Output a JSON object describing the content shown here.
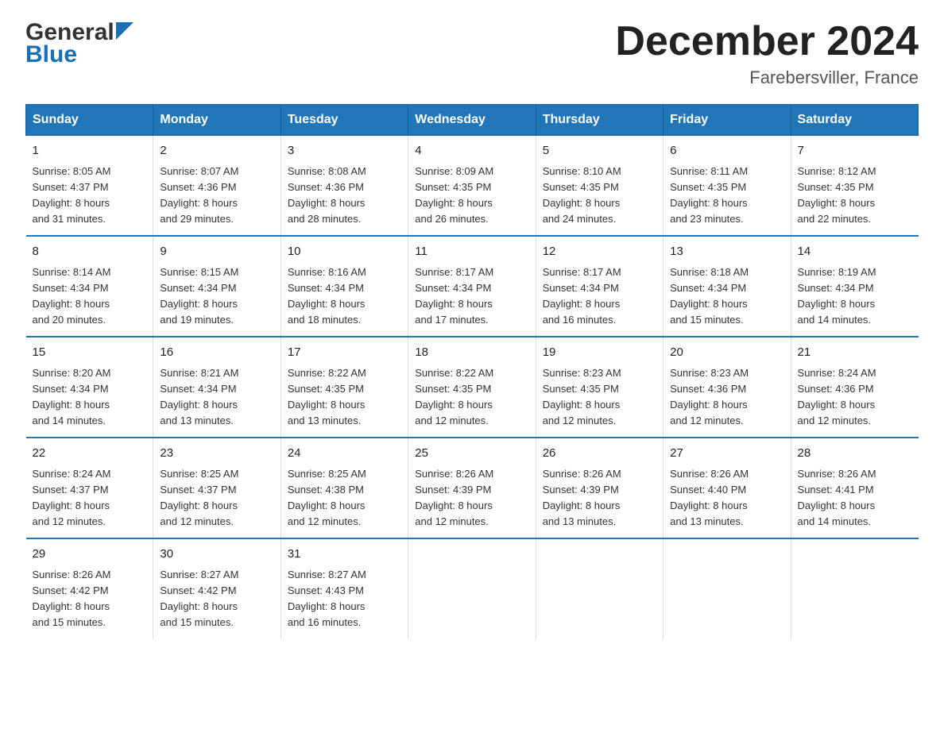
{
  "header": {
    "logo_general": "General",
    "logo_blue": "Blue",
    "month_year": "December 2024",
    "location": "Farebersviller, France"
  },
  "days_of_week": [
    "Sunday",
    "Monday",
    "Tuesday",
    "Wednesday",
    "Thursday",
    "Friday",
    "Saturday"
  ],
  "weeks": [
    [
      {
        "day": "1",
        "sunrise": "8:05 AM",
        "sunset": "4:37 PM",
        "daylight": "8 hours and 31 minutes."
      },
      {
        "day": "2",
        "sunrise": "8:07 AM",
        "sunset": "4:36 PM",
        "daylight": "8 hours and 29 minutes."
      },
      {
        "day": "3",
        "sunrise": "8:08 AM",
        "sunset": "4:36 PM",
        "daylight": "8 hours and 28 minutes."
      },
      {
        "day": "4",
        "sunrise": "8:09 AM",
        "sunset": "4:35 PM",
        "daylight": "8 hours and 26 minutes."
      },
      {
        "day": "5",
        "sunrise": "8:10 AM",
        "sunset": "4:35 PM",
        "daylight": "8 hours and 24 minutes."
      },
      {
        "day": "6",
        "sunrise": "8:11 AM",
        "sunset": "4:35 PM",
        "daylight": "8 hours and 23 minutes."
      },
      {
        "day": "7",
        "sunrise": "8:12 AM",
        "sunset": "4:35 PM",
        "daylight": "8 hours and 22 minutes."
      }
    ],
    [
      {
        "day": "8",
        "sunrise": "8:14 AM",
        "sunset": "4:34 PM",
        "daylight": "8 hours and 20 minutes."
      },
      {
        "day": "9",
        "sunrise": "8:15 AM",
        "sunset": "4:34 PM",
        "daylight": "8 hours and 19 minutes."
      },
      {
        "day": "10",
        "sunrise": "8:16 AM",
        "sunset": "4:34 PM",
        "daylight": "8 hours and 18 minutes."
      },
      {
        "day": "11",
        "sunrise": "8:17 AM",
        "sunset": "4:34 PM",
        "daylight": "8 hours and 17 minutes."
      },
      {
        "day": "12",
        "sunrise": "8:17 AM",
        "sunset": "4:34 PM",
        "daylight": "8 hours and 16 minutes."
      },
      {
        "day": "13",
        "sunrise": "8:18 AM",
        "sunset": "4:34 PM",
        "daylight": "8 hours and 15 minutes."
      },
      {
        "day": "14",
        "sunrise": "8:19 AM",
        "sunset": "4:34 PM",
        "daylight": "8 hours and 14 minutes."
      }
    ],
    [
      {
        "day": "15",
        "sunrise": "8:20 AM",
        "sunset": "4:34 PM",
        "daylight": "8 hours and 14 minutes."
      },
      {
        "day": "16",
        "sunrise": "8:21 AM",
        "sunset": "4:34 PM",
        "daylight": "8 hours and 13 minutes."
      },
      {
        "day": "17",
        "sunrise": "8:22 AM",
        "sunset": "4:35 PM",
        "daylight": "8 hours and 13 minutes."
      },
      {
        "day": "18",
        "sunrise": "8:22 AM",
        "sunset": "4:35 PM",
        "daylight": "8 hours and 12 minutes."
      },
      {
        "day": "19",
        "sunrise": "8:23 AM",
        "sunset": "4:35 PM",
        "daylight": "8 hours and 12 minutes."
      },
      {
        "day": "20",
        "sunrise": "8:23 AM",
        "sunset": "4:36 PM",
        "daylight": "8 hours and 12 minutes."
      },
      {
        "day": "21",
        "sunrise": "8:24 AM",
        "sunset": "4:36 PM",
        "daylight": "8 hours and 12 minutes."
      }
    ],
    [
      {
        "day": "22",
        "sunrise": "8:24 AM",
        "sunset": "4:37 PM",
        "daylight": "8 hours and 12 minutes."
      },
      {
        "day": "23",
        "sunrise": "8:25 AM",
        "sunset": "4:37 PM",
        "daylight": "8 hours and 12 minutes."
      },
      {
        "day": "24",
        "sunrise": "8:25 AM",
        "sunset": "4:38 PM",
        "daylight": "8 hours and 12 minutes."
      },
      {
        "day": "25",
        "sunrise": "8:26 AM",
        "sunset": "4:39 PM",
        "daylight": "8 hours and 12 minutes."
      },
      {
        "day": "26",
        "sunrise": "8:26 AM",
        "sunset": "4:39 PM",
        "daylight": "8 hours and 13 minutes."
      },
      {
        "day": "27",
        "sunrise": "8:26 AM",
        "sunset": "4:40 PM",
        "daylight": "8 hours and 13 minutes."
      },
      {
        "day": "28",
        "sunrise": "8:26 AM",
        "sunset": "4:41 PM",
        "daylight": "8 hours and 14 minutes."
      }
    ],
    [
      {
        "day": "29",
        "sunrise": "8:26 AM",
        "sunset": "4:42 PM",
        "daylight": "8 hours and 15 minutes."
      },
      {
        "day": "30",
        "sunrise": "8:27 AM",
        "sunset": "4:42 PM",
        "daylight": "8 hours and 15 minutes."
      },
      {
        "day": "31",
        "sunrise": "8:27 AM",
        "sunset": "4:43 PM",
        "daylight": "8 hours and 16 minutes."
      },
      {
        "day": "",
        "sunrise": "",
        "sunset": "",
        "daylight": ""
      },
      {
        "day": "",
        "sunrise": "",
        "sunset": "",
        "daylight": ""
      },
      {
        "day": "",
        "sunrise": "",
        "sunset": "",
        "daylight": ""
      },
      {
        "day": "",
        "sunrise": "",
        "sunset": "",
        "daylight": ""
      }
    ]
  ],
  "labels": {
    "sunrise_prefix": "Sunrise: ",
    "sunset_prefix": "Sunset: ",
    "daylight_prefix": "Daylight: "
  }
}
